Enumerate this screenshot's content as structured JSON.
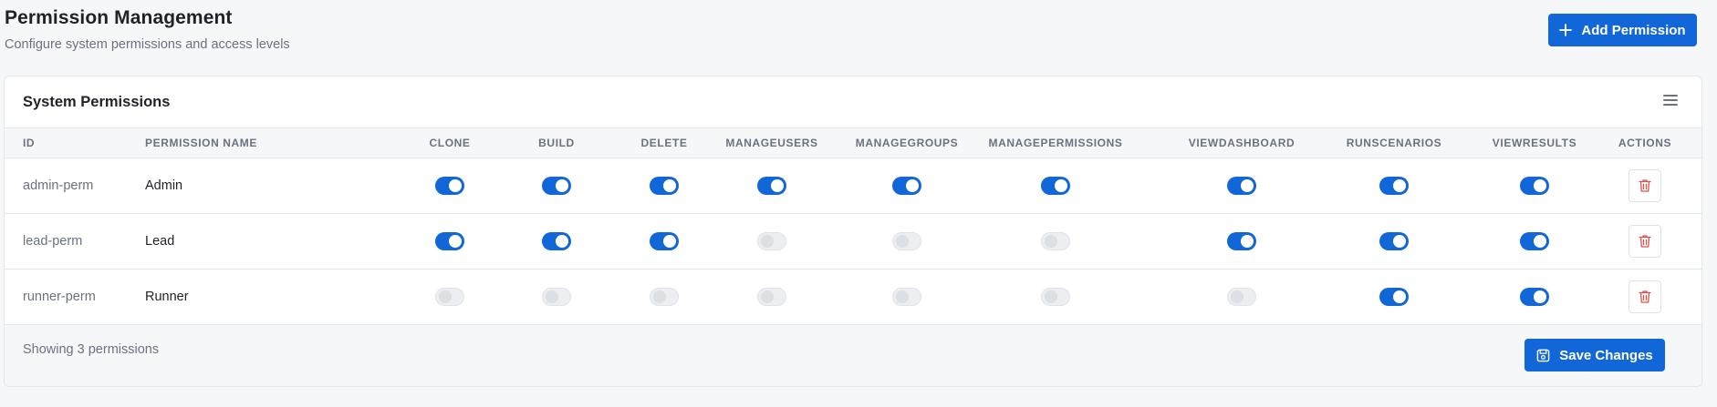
{
  "header": {
    "title": "Permission Management",
    "subtitle": "Configure system permissions and access levels",
    "add_button_label": "Add Permission"
  },
  "card": {
    "title": "System Permissions"
  },
  "table": {
    "columns": [
      "ID",
      "PERMISSION NAME",
      "CLONE",
      "BUILD",
      "DELETE",
      "MANAGEUSERS",
      "MANAGEGROUPS",
      "MANAGEPERMISSIONS",
      "VIEWDASHBOARD",
      "RUNSCENARIOS",
      "VIEWRESULTS",
      "ACTIONS"
    ],
    "permission_keys": [
      "CLONE",
      "BUILD",
      "DELETE",
      "MANAGEUSERS",
      "MANAGEGROUPS",
      "MANAGEPERMISSIONS",
      "VIEWDASHBOARD",
      "RUNSCENARIOS",
      "VIEWRESULTS"
    ],
    "rows": [
      {
        "id": "admin-perm",
        "name": "Admin",
        "flags": [
          true,
          true,
          true,
          true,
          true,
          true,
          true,
          true,
          true
        ]
      },
      {
        "id": "lead-perm",
        "name": "Lead",
        "flags": [
          true,
          true,
          true,
          false,
          false,
          false,
          true,
          true,
          true
        ]
      },
      {
        "id": "runner-perm",
        "name": "Runner",
        "flags": [
          false,
          false,
          false,
          false,
          false,
          false,
          false,
          true,
          true
        ]
      }
    ]
  },
  "footer": {
    "status": "Showing 3 permissions",
    "save_button_label": "Save Changes"
  },
  "icons": {
    "add": "plus-icon",
    "menu": "menu-icon",
    "delete": "trash-icon",
    "save": "save-icon"
  },
  "colors": {
    "accent": "#1267d8",
    "danger": "#d9534f",
    "toggle_off": "#eceef1"
  }
}
